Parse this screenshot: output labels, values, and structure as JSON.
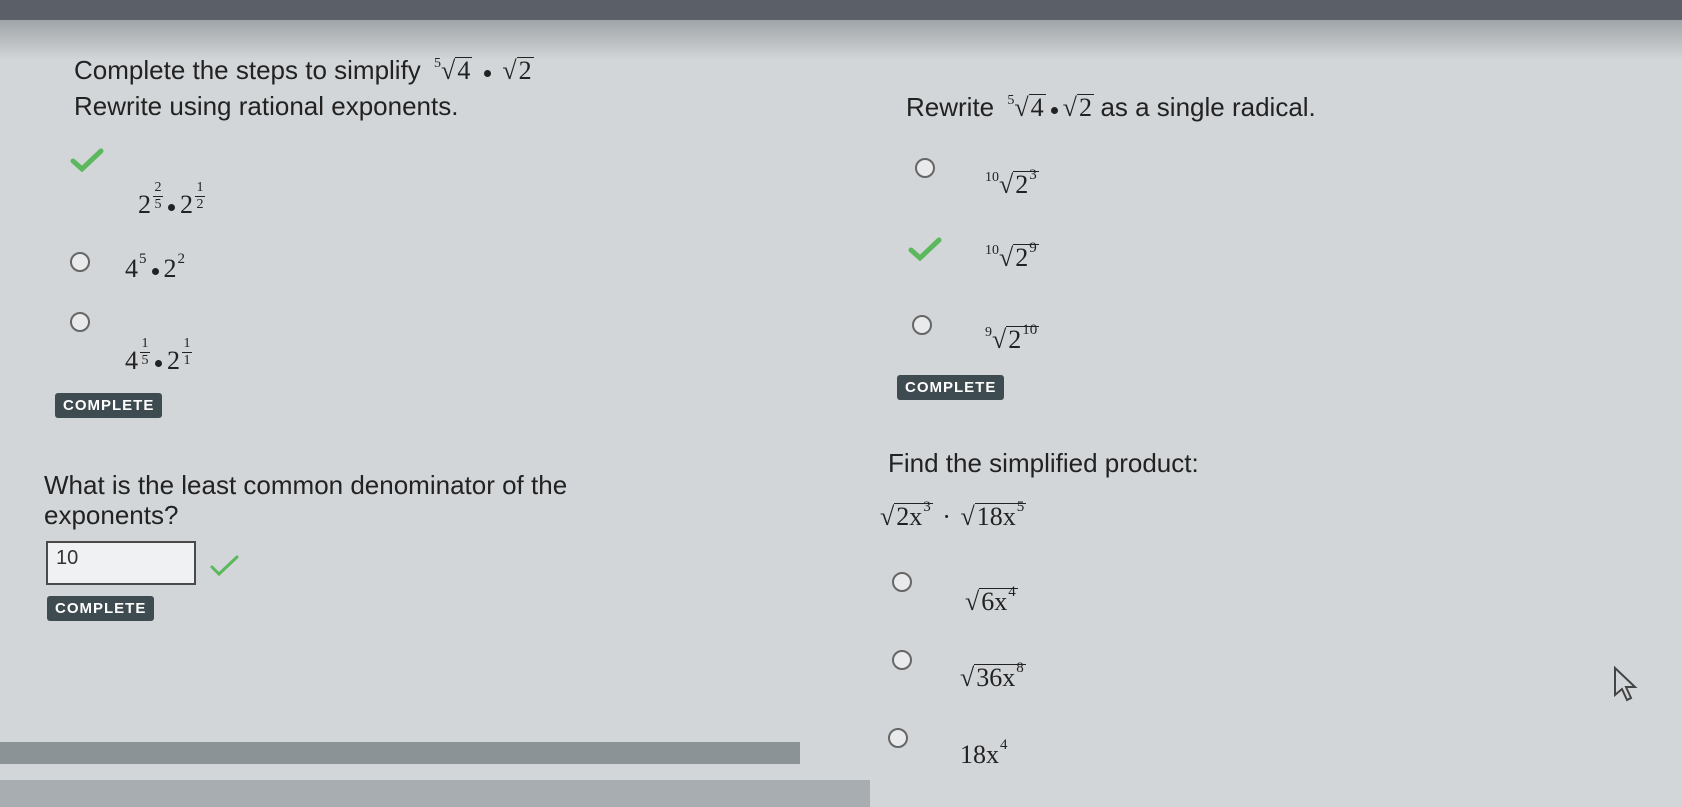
{
  "left_panel": {
    "question1_line1": "Complete the steps to simplify",
    "question1_expr": {
      "index": "5",
      "radicand1": "4",
      "radicand2": "2"
    },
    "question1_line2": "Rewrite using rational exponents.",
    "options": [
      {
        "base1": "2",
        "num1": "2",
        "den1": "5",
        "base2": "2",
        "num2": "1",
        "den2": "2",
        "status": "correct"
      },
      {
        "base1": "4",
        "exp1": "5",
        "base2": "2",
        "exp2": "2",
        "status": "unselected"
      },
      {
        "base1": "4",
        "num1": "1",
        "den1": "5",
        "base2": "2",
        "num2": "1",
        "den2": "1",
        "status": "unselected"
      }
    ],
    "complete1": "COMPLETE",
    "question2_line1": "What is the least common denominator of the",
    "question2_line2": "exponents?",
    "answer_value": "10",
    "complete2": "COMPLETE"
  },
  "right_panel": {
    "question3_prefix": "Rewrite",
    "question3_expr": {
      "index": "5",
      "radicand1": "4",
      "radicand2": "2"
    },
    "question3_suffix": "as a single radical.",
    "options": [
      {
        "index": "10",
        "base": "2",
        "exp": "3",
        "status": "unselected"
      },
      {
        "index": "10",
        "base": "2",
        "exp": "9",
        "status": "correct"
      },
      {
        "index": "9",
        "base": "2",
        "exp": "10",
        "status": "unselected"
      }
    ],
    "complete3": "COMPLETE",
    "question4": "Find the simplified product:",
    "question4_expr": {
      "r1": "2x",
      "e1": "3",
      "r2": "18x",
      "e2": "5"
    },
    "options2": [
      {
        "radicand": "6x",
        "exp": "4"
      },
      {
        "radicand": "36x",
        "exp": "8"
      },
      {
        "text": "18x",
        "exp": "4"
      }
    ]
  },
  "colors": {
    "check": "#5cb85c",
    "button": "#3e4b50",
    "background": "#d3d6d8"
  }
}
